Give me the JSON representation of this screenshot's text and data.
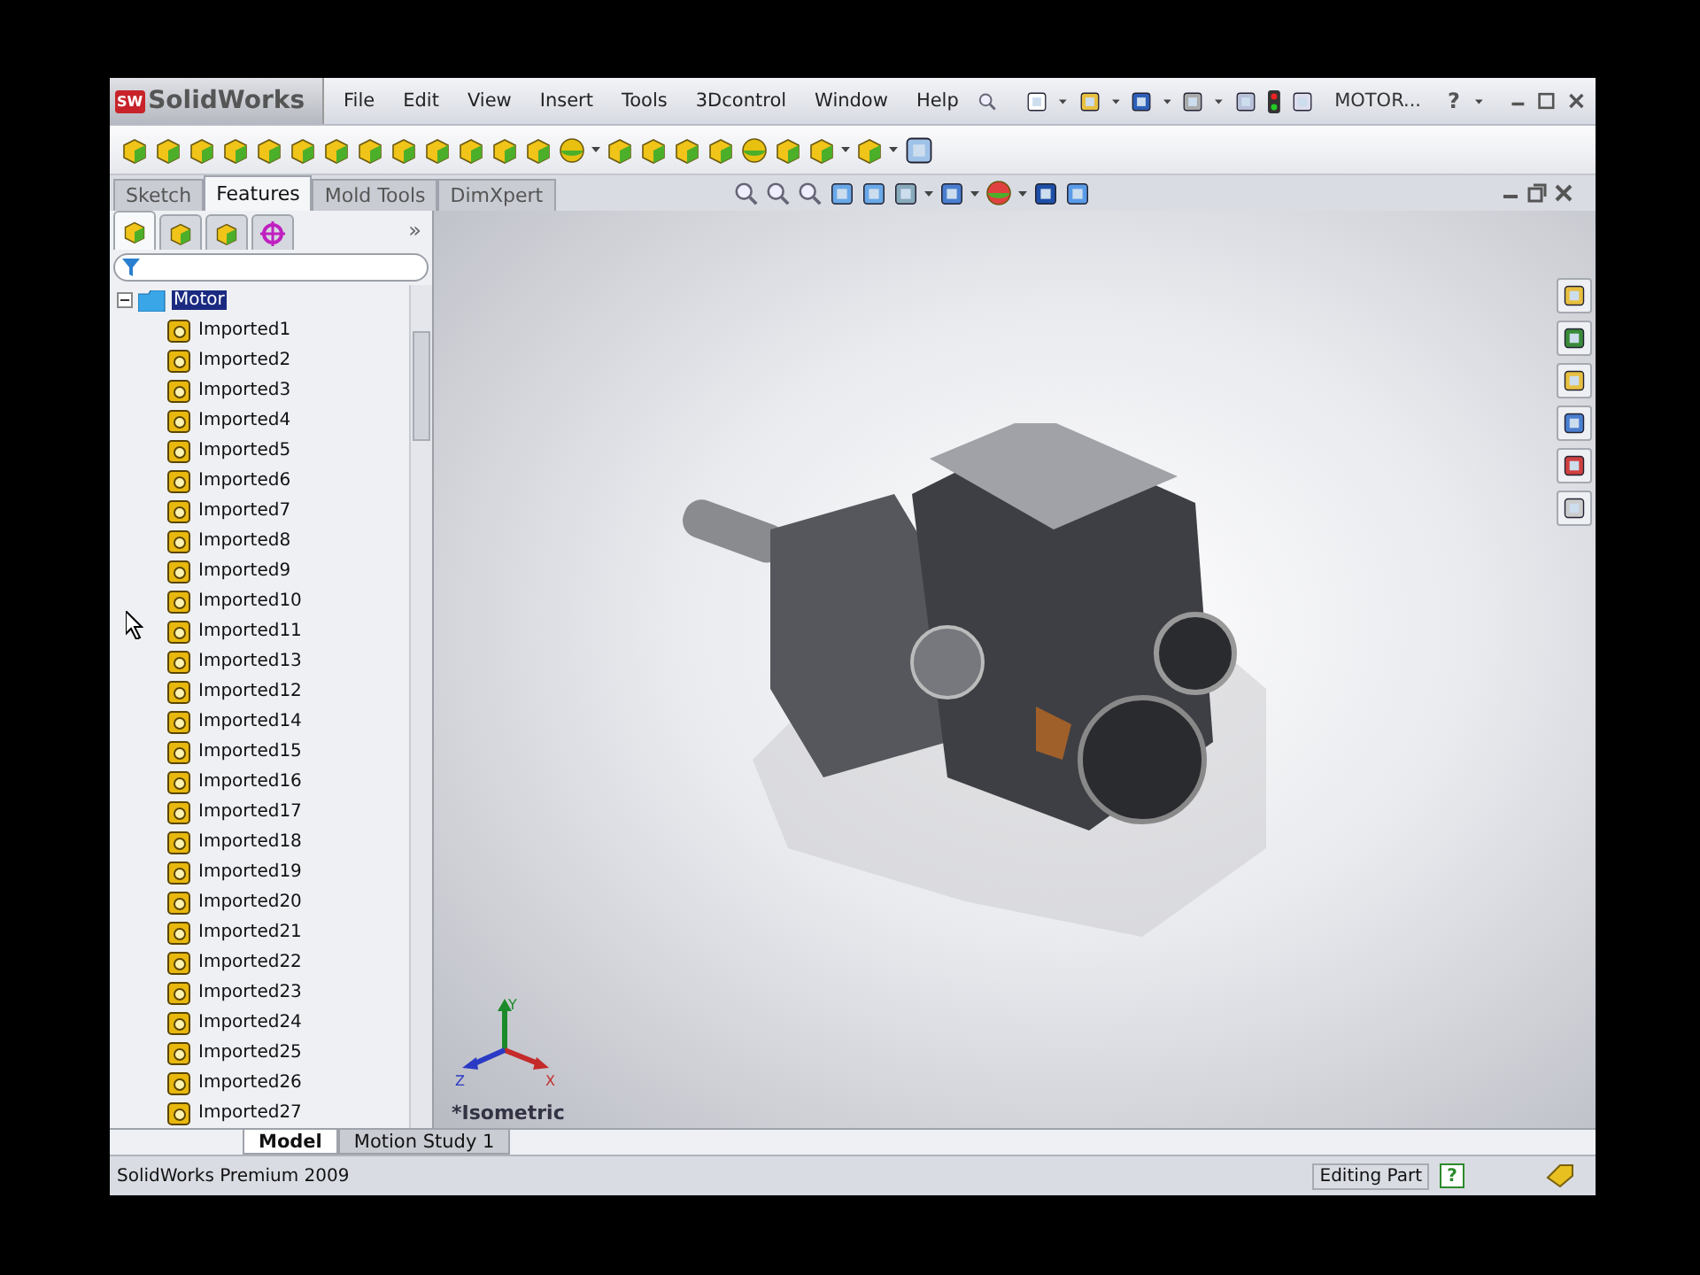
{
  "app": {
    "logo_badge": "SW",
    "logo_text": "SolidWorks"
  },
  "menu": [
    "File",
    "Edit",
    "View",
    "Insert",
    "Tools",
    "3Dcontrol",
    "Window",
    "Help"
  ],
  "document_title": "MOTOR...",
  "help_button": "?",
  "command_tabs": [
    {
      "label": "Sketch",
      "selected": false
    },
    {
      "label": "Features",
      "selected": true
    },
    {
      "label": "Mold Tools",
      "selected": false
    },
    {
      "label": "DimXpert",
      "selected": false
    }
  ],
  "feature_panel": {
    "panel_tabs": [
      {
        "selected": true
      },
      {
        "selected": false
      },
      {
        "selected": false
      },
      {
        "selected": false
      }
    ],
    "expand_button": "»",
    "tree": {
      "label": "Motor",
      "selected": true,
      "expanded": true,
      "children": [
        {
          "label": "Imported1",
          "selected": false
        },
        {
          "label": "Imported2",
          "selected": false
        },
        {
          "label": "Imported3",
          "selected": false
        },
        {
          "label": "Imported4",
          "selected": false
        },
        {
          "label": "Imported5",
          "selected": false
        },
        {
          "label": "Imported6",
          "selected": false
        },
        {
          "label": "Imported7",
          "selected": false
        },
        {
          "label": "Imported8",
          "selected": false
        },
        {
          "label": "Imported9",
          "selected": false
        },
        {
          "label": "Imported10",
          "selected": false
        },
        {
          "label": "Imported11",
          "selected": false
        },
        {
          "label": "Imported13",
          "selected": false
        },
        {
          "label": "Imported12",
          "selected": false
        },
        {
          "label": "Imported14",
          "selected": false
        },
        {
          "label": "Imported15",
          "selected": false
        },
        {
          "label": "Imported16",
          "selected": false
        },
        {
          "label": "Imported17",
          "selected": false
        },
        {
          "label": "Imported18",
          "selected": false
        },
        {
          "label": "Imported19",
          "selected": false
        },
        {
          "label": "Imported20",
          "selected": false
        },
        {
          "label": "Imported21",
          "selected": false
        },
        {
          "label": "Imported22",
          "selected": false
        },
        {
          "label": "Imported23",
          "selected": false
        },
        {
          "label": "Imported24",
          "selected": false
        },
        {
          "label": "Imported25",
          "selected": false
        },
        {
          "label": "Imported26",
          "selected": false
        },
        {
          "label": "Imported27",
          "selected": false
        }
      ]
    }
  },
  "triad": {
    "x": "X",
    "y": "Y",
    "z": "Z"
  },
  "view_label": "*Isometric",
  "bottom_tabs": [
    {
      "label": "Model",
      "selected": true
    },
    {
      "label": "Motion Study 1",
      "selected": false
    }
  ],
  "status_bar": {
    "product": "SolidWorks Premium 2009",
    "mode": "Editing Part",
    "help": "?"
  }
}
